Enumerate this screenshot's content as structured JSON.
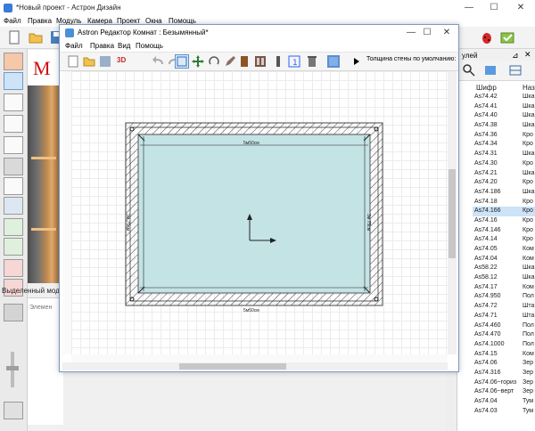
{
  "main_window": {
    "title": "*Новый проект - Астрон Дизайн",
    "menu": [
      "Файл",
      "Правка",
      "Модуль",
      "Камера",
      "Проект",
      "Окна",
      "Помощь"
    ]
  },
  "preview": {
    "brand_letter": "M"
  },
  "selected_module": {
    "label": "Выделенный модуль",
    "tab": "Элемен"
  },
  "catalog": {
    "header_partial": "улей",
    "col_code": "Шифр",
    "col_name": "Назв",
    "rows": [
      {
        "code": "As74.42",
        "name": "Шка"
      },
      {
        "code": "As74.41",
        "name": "Шка"
      },
      {
        "code": "As74.40",
        "name": "Шка"
      },
      {
        "code": "As74.38",
        "name": "Шка"
      },
      {
        "code": "As74.36",
        "name": "Кро"
      },
      {
        "code": "As74.34",
        "name": "Кро"
      },
      {
        "code": "As74.31",
        "name": "Шка"
      },
      {
        "code": "As74.30",
        "name": "Кро"
      },
      {
        "code": "As74.21",
        "name": "Шка"
      },
      {
        "code": "As74.20",
        "name": "Кро"
      },
      {
        "code": "As74.186",
        "name": "Шка"
      },
      {
        "code": "As74.18",
        "name": "Кро"
      },
      {
        "code": "As74.166",
        "name": "Кро"
      },
      {
        "code": "As74.16",
        "name": "Кро"
      },
      {
        "code": "As74.146",
        "name": "Кро"
      },
      {
        "code": "As74.14",
        "name": "Кро"
      },
      {
        "code": "As74.05",
        "name": "Ком"
      },
      {
        "code": "As74.04",
        "name": "Ком"
      },
      {
        "code": "As58.22",
        "name": "Шка"
      },
      {
        "code": "As58.12",
        "name": "Шка"
      },
      {
        "code": "As74.17",
        "name": "Ком"
      },
      {
        "code": "As74.950",
        "name": "Пол"
      },
      {
        "code": "As74.72",
        "name": "Шта"
      },
      {
        "code": "As74.71",
        "name": "Шта"
      },
      {
        "code": "As74.460",
        "name": "Пол"
      },
      {
        "code": "As74.470",
        "name": "Пол"
      },
      {
        "code": "As74.1000",
        "name": "Пол"
      },
      {
        "code": "As74.15",
        "name": "Ком"
      },
      {
        "code": "As74.06",
        "name": "Зер"
      },
      {
        "code": "As74.316",
        "name": "Зер"
      },
      {
        "code": "As74.06~гориз",
        "name": "Зер"
      },
      {
        "code": "As74.06~верт",
        "name": "Зер"
      },
      {
        "code": "As74.04",
        "name": "Тум"
      },
      {
        "code": "As74.03",
        "name": "Тум"
      }
    ],
    "selected_index": 12
  },
  "editor": {
    "title": "Astron Редактор Комнат : Безымянный*",
    "menu": [
      "Файл",
      "Правка",
      "Вид",
      "Помощь"
    ],
    "toolbar_3d": "3D",
    "wall_thickness_label": "Толщина стены по умолчанию:",
    "room": {
      "width_label": "5м50см",
      "height_label": "3м 75см",
      "fill_color": "#c4e3e5",
      "wall_color": "#555555"
    }
  },
  "colors": {
    "accent": "#3a7bd5",
    "selection": "#cce3f8",
    "brand_red": "#cc1111"
  }
}
